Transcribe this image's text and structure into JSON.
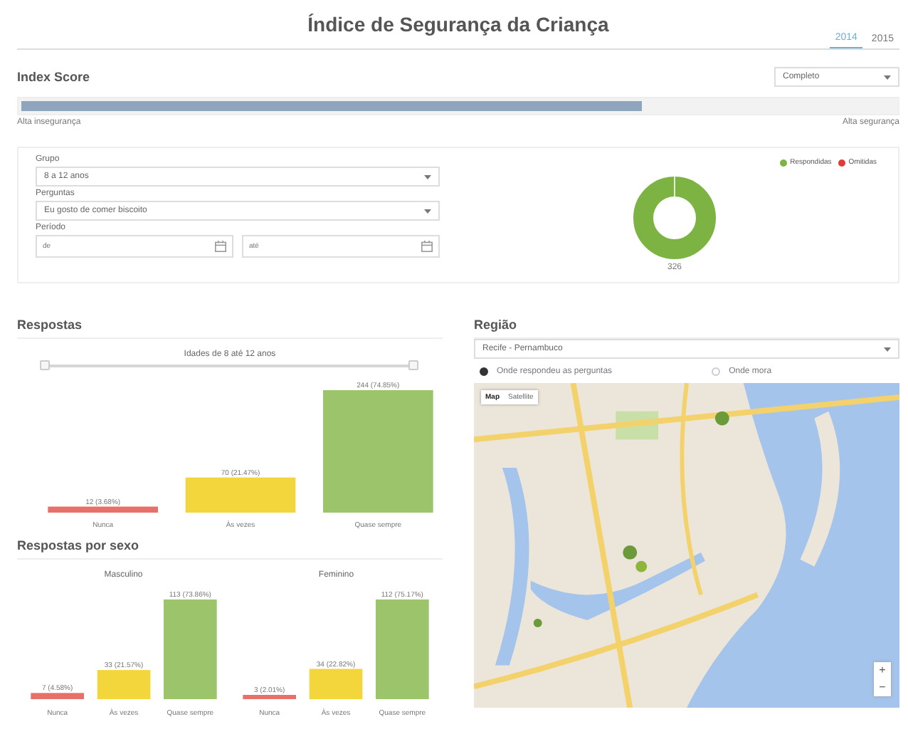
{
  "header": {
    "title": "Índice de Segurança da Criança"
  },
  "year_tabs": [
    {
      "label": "2014",
      "selected": true
    },
    {
      "label": "2015",
      "selected": false
    }
  ],
  "index_score": {
    "title": "Index Score",
    "dropdown": "Completo",
    "level": 0.71,
    "min_label": "Alta insegurança",
    "max_label": "Alta segurança"
  },
  "filters": {
    "group_label": "Grupo",
    "group_value": "8 a 12 anos",
    "question_label": "Perguntas",
    "question_value": "Eu gosto de comer biscoito",
    "period_label": "Período",
    "from_placeholder": "de",
    "to_placeholder": "até"
  },
  "donut": {
    "legend": [
      {
        "label": "Respondidas",
        "color": "#7cb342"
      },
      {
        "label": "Omitidas",
        "color": "#e53935"
      }
    ],
    "total": "326"
  },
  "respostas": {
    "title": "Respostas",
    "slider_label": "Idades de 8 até 12 anos",
    "level": 1,
    "chart_data": {
      "type": "bar",
      "categories": [
        "Nunca",
        "Às vezes",
        "Quase sempre"
      ],
      "values": [
        12,
        70,
        244
      ],
      "value_labels": [
        "12 (3.68%)",
        "70 (21.47%)",
        "244 (74.85%)"
      ],
      "colors": [
        "#e8706b",
        "#f2d63c",
        "#9cc46a"
      ]
    }
  },
  "por_sexo": {
    "title": "Respostas por sexo",
    "charts": [
      {
        "title": "Masculino",
        "chart_data": {
          "type": "bar",
          "categories": [
            "Nunca",
            "Às vezes",
            "Quase sempre"
          ],
          "values": [
            7,
            33,
            113
          ],
          "value_labels": [
            "7 (4.58%)",
            "33 (21.57%)",
            "113 (73.86%)"
          ]
        }
      },
      {
        "title": "Feminino",
        "chart_data": {
          "type": "bar",
          "categories": [
            "Nunca",
            "Às vezes",
            "Quase sempre"
          ],
          "values": [
            3,
            34,
            112
          ],
          "value_labels": [
            "3 (2.01%)",
            "34 (22.82%)",
            "112 (75.17%)"
          ]
        }
      }
    ]
  },
  "regiao": {
    "title": "Região",
    "dropdown": "Recife - Pernambuco",
    "radios": [
      {
        "label": "Onde respondeu as perguntas",
        "selected": true
      },
      {
        "label": "Onde mora",
        "selected": false
      }
    ],
    "map": {
      "kind": "picture",
      "map_types": [
        {
          "label": "Map",
          "selected": true
        },
        {
          "label": "Satellite",
          "selected": false
        }
      ],
      "zoom_in": "+",
      "zoom_out": "−"
    }
  }
}
